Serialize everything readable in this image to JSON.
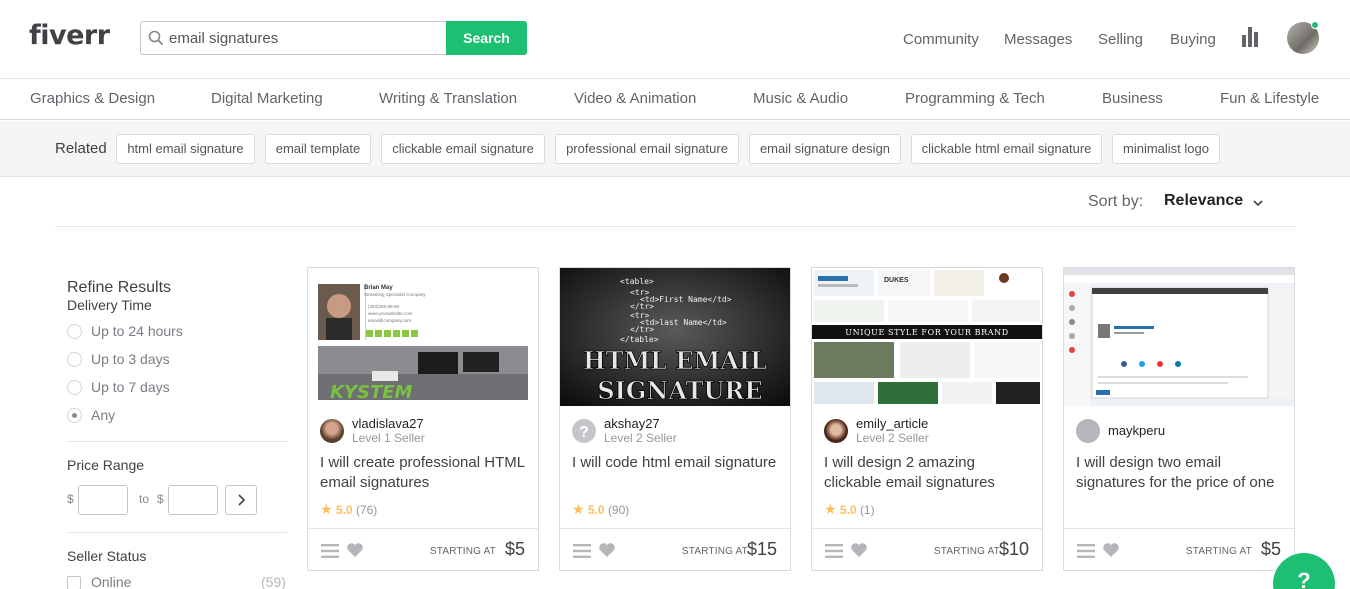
{
  "header": {
    "logo": "fiverr",
    "search_value": "email signatures",
    "search_button": "Search",
    "nav": [
      "Community",
      "Messages",
      "Selling",
      "Buying"
    ],
    "stats_icon": "bar-chart-icon",
    "online_color": "#1dbf73"
  },
  "categories": [
    "Graphics & Design",
    "Digital Marketing",
    "Writing & Translation",
    "Video & Animation",
    "Music & Audio",
    "Programming & Tech",
    "Business",
    "Fun & Lifestyle"
  ],
  "related": {
    "label": "Related",
    "chips": [
      "html email signature",
      "email template",
      "clickable email signature",
      "professional email signature",
      "email signature design",
      "clickable html email signature",
      "minimalist logo"
    ]
  },
  "sort": {
    "label": "Sort by:",
    "value": "Relevance"
  },
  "sidebar": {
    "title": "Refine Results",
    "delivery_title": "Delivery Time",
    "delivery_options": [
      "Up to 24 hours",
      "Up to 3 days",
      "Up to 7 days",
      "Any"
    ],
    "delivery_selected": "Any",
    "price_title": "Price Range",
    "currency": "$",
    "to_label": "to",
    "seller_status_title": "Seller Status",
    "online_label": "Online",
    "online_count": "(59)"
  },
  "gigs": [
    {
      "seller": "vladislava27",
      "level": "Level 1 Seller",
      "title": "I will create professional HTML email signatures",
      "rating": "5.0",
      "reviews": "(76)",
      "starting": "STARTING AT",
      "price": "$5",
      "thumb": {
        "name": "Brian May",
        "role": "Streaming Specialist",
        "company": "Company",
        "phone": "(254)256-89-65",
        "web": "www.yourwebsite.com",
        "mail": "email@company.com",
        "banner": "KYSTEM"
      }
    },
    {
      "seller": "akshay27",
      "level": "Level 2 Seller",
      "title": "I will code html email signature",
      "rating": "5.0",
      "reviews": "(90)",
      "starting": "STARTING AT",
      "price": "$15",
      "thumb": {
        "code": [
          "<table>",
          "<tr>",
          "<td>First Name</td>",
          "</tr>",
          "<tr>",
          "<td>last Name</td>",
          "</tr>",
          "</table>"
        ],
        "line1": "HTML EMAIL",
        "line2": "SIGNATURE"
      }
    },
    {
      "seller": "emily_article",
      "level": "Level 2 Seller",
      "title": "I will design 2 amazing clickable email signatures",
      "rating": "5.0",
      "reviews": "(1)",
      "starting": "STARTING AT",
      "price": "$10",
      "thumb": {
        "banner": "UNIQUE STYLE FOR YOUR BRAND",
        "brand": "DUKES"
      }
    },
    {
      "seller": "maykperu",
      "level": "",
      "title": "I will design two email signatures for the price of one",
      "rating": "",
      "reviews": "",
      "starting": "STARTING AT",
      "price": "$5",
      "thumb": {}
    }
  ],
  "help": "?"
}
